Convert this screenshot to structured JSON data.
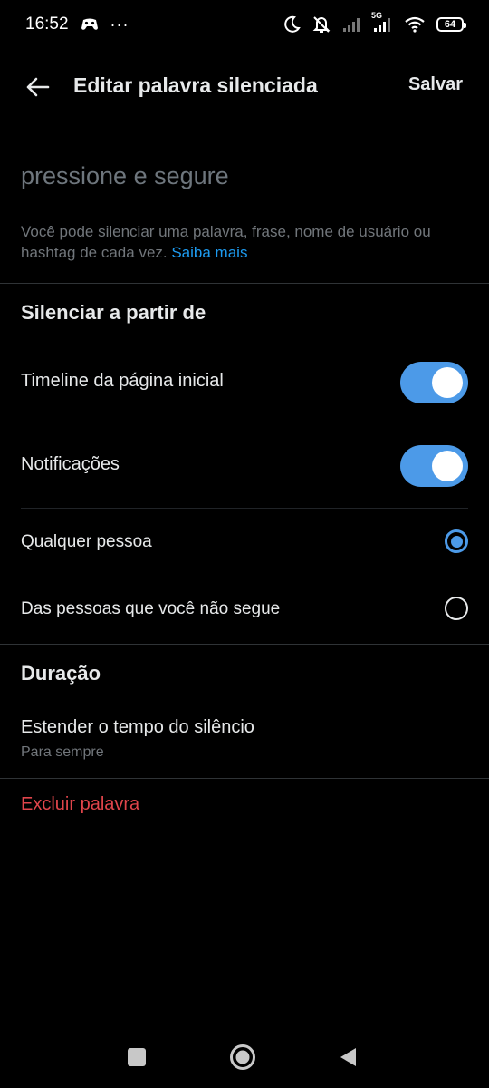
{
  "status_bar": {
    "time": "16:52",
    "more": "···",
    "network": "5G",
    "battery": "64"
  },
  "header": {
    "title": "Editar palavra silenciada",
    "save_label": "Salvar"
  },
  "word_input": {
    "value": "",
    "placeholder": "pressione e segure"
  },
  "helper": {
    "text": "Você pode silenciar uma palavra, frase, nome de usuário ou hashtag de cada vez. ",
    "link": "Saiba mais"
  },
  "mute_from": {
    "heading": "Silenciar a partir de",
    "toggles": [
      {
        "label": "Timeline da página inicial",
        "on": true
      },
      {
        "label": "Notificações",
        "on": true
      }
    ],
    "audience": [
      {
        "label": "Qualquer pessoa",
        "selected": true
      },
      {
        "label": "Das pessoas que você não segue",
        "selected": false
      }
    ]
  },
  "duration": {
    "heading": "Duração",
    "row_title": "Estender o tempo do silêncio",
    "row_value": "Para sempre"
  },
  "delete_label": "Excluir palavra",
  "colors": {
    "background": "#000000",
    "accent": "#4c9ae8",
    "link": "#1d9bf0",
    "danger": "#e0454b",
    "secondary_text": "#71767b"
  }
}
